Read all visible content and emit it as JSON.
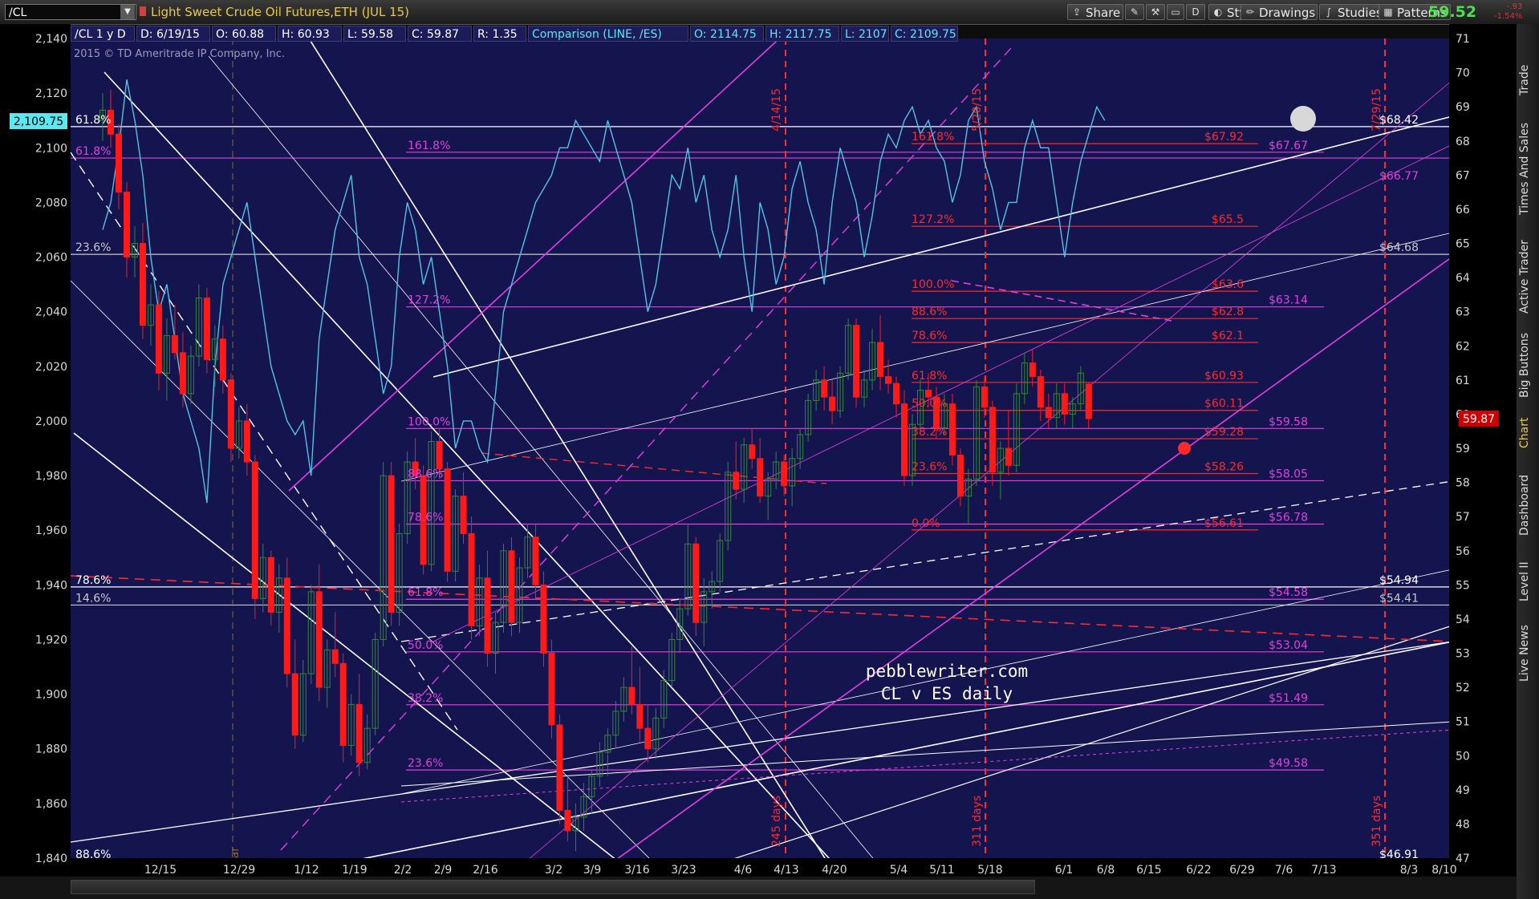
{
  "toolbar": {
    "symbol": "/CL",
    "title": "Light Sweet Crude Oil Futures,ETH (JUL 15)",
    "buttons": {
      "share": "Share",
      "style": "Style",
      "drawings": "Drawings",
      "studies": "Studies",
      "patterns": "Patterns"
    },
    "period_btn": "D",
    "last_price": "59.52",
    "last_change_1": "-.93",
    "last_change_2": "-1.54%"
  },
  "info": {
    "symbol_period": "/CL 1 y D",
    "date": "D: 6/19/15",
    "open": "O: 60.88",
    "high": "H: 60.93",
    "low": "L: 59.58",
    "close": "C: 59.87",
    "range": "R: 1.35",
    "comparison": "Comparison (LINE, /ES)",
    "cmp_open": "O: 2114.75",
    "cmp_high": "H: 2117.75",
    "cmp_low": "L: 2107",
    "cmp_close": "C: 2109.75"
  },
  "copyright": "2015 © TD Ameritrade IP Company, Inc.",
  "watermark": {
    "line1": "pebblewriter.com",
    "line2": "CL v ES daily"
  },
  "side_tabs": [
    "Trade",
    "Times And Sales",
    "Active Trader",
    "Big Buttons",
    "Chart",
    "Dashboard",
    "Level II",
    "Live News"
  ],
  "colors": {
    "bg": "#14144e",
    "up": "#2e8b2e",
    "down": "#ff1a1a",
    "es_line": "#4fc3e8",
    "magenta": "#e040e0",
    "white": "#ffffff",
    "red": "#ff2a2a",
    "current_price_tag": "#cc0000",
    "left_price_tag": "#5ce8f0"
  },
  "chart_data": {
    "type": "candlestick",
    "primary": "/CL",
    "comparison_series": "/ES",
    "x_ticks": [
      "12/15",
      "12/29",
      "1/12",
      "1/19",
      "2/2",
      "2/9",
      "2/16",
      "3/2",
      "3/9",
      "3/16",
      "3/23",
      "4/6",
      "4/13",
      "4/20",
      "5/4",
      "5/11",
      "5/18",
      "6/1",
      "6/8",
      "6/15",
      "6/22",
      "6/29",
      "7/6",
      "7/13",
      "8/3",
      "8/10"
    ],
    "left_axis": {
      "label": "/ES",
      "min": 1840,
      "max": 2140,
      "ticks": [
        "2,140",
        "2,120",
        "2,100",
        "2,080",
        "2,060",
        "2,040",
        "2,020",
        "2,000",
        "1,980",
        "1,960",
        "1,940",
        "1,920",
        "1,900",
        "1,880",
        "1,860",
        "1,840"
      ],
      "current": "2,109.75"
    },
    "right_axis": {
      "label": "/CL",
      "min": 47,
      "max": 71,
      "ticks": [
        "71",
        "70",
        "69",
        "68",
        "67",
        "66",
        "65",
        "64",
        "63",
        "62",
        "61",
        "60",
        "59",
        "58",
        "57",
        "56",
        "55",
        "54",
        "53",
        "52",
        "51",
        "50",
        "49",
        "48",
        "47"
      ],
      "current": "59.87"
    },
    "cl_candles": [
      [
        68.6,
        69.4,
        68.0,
        68.9
      ],
      [
        68.9,
        69.5,
        67.8,
        68.2
      ],
      [
        68.2,
        68.5,
        66.0,
        66.5
      ],
      [
        66.5,
        66.8,
        64.0,
        64.6
      ],
      [
        64.6,
        65.5,
        64.0,
        65.0
      ],
      [
        65.0,
        65.6,
        62.2,
        62.6
      ],
      [
        62.6,
        63.8,
        62.0,
        63.2
      ],
      [
        63.2,
        63.6,
        60.7,
        61.2
      ],
      [
        61.2,
        62.8,
        60.4,
        62.3
      ],
      [
        62.3,
        63.2,
        61.6,
        61.8
      ],
      [
        61.8,
        62.4,
        60.2,
        60.6
      ],
      [
        60.6,
        62.0,
        60.3,
        61.7
      ],
      [
        61.7,
        63.8,
        61.4,
        63.4
      ],
      [
        63.4,
        63.7,
        61.2,
        61.6
      ],
      [
        61.6,
        62.6,
        60.8,
        62.2
      ],
      [
        62.2,
        62.6,
        60.6,
        61.0
      ],
      [
        61.0,
        61.2,
        58.6,
        59.0
      ],
      [
        59.0,
        60.2,
        58.7,
        59.8
      ],
      [
        59.8,
        60.3,
        58.2,
        58.6
      ],
      [
        58.6,
        58.8,
        54.0,
        54.6
      ],
      [
        54.6,
        56.2,
        54.2,
        55.8
      ],
      [
        55.8,
        56.0,
        53.8,
        54.2
      ],
      [
        54.2,
        55.6,
        53.6,
        55.2
      ],
      [
        55.2,
        55.8,
        52.0,
        52.4
      ],
      [
        52.4,
        53.4,
        50.2,
        50.6
      ],
      [
        50.6,
        52.8,
        50.4,
        52.4
      ],
      [
        52.4,
        55.0,
        52.1,
        54.8
      ],
      [
        54.8,
        55.6,
        51.6,
        52.0
      ],
      [
        52.0,
        53.4,
        51.4,
        53.1
      ],
      [
        53.1,
        54.2,
        52.3,
        52.7
      ],
      [
        52.7,
        53.0,
        49.8,
        50.3
      ],
      [
        50.3,
        51.8,
        50.0,
        51.5
      ],
      [
        51.5,
        52.4,
        49.4,
        49.8
      ],
      [
        49.8,
        51.2,
        49.6,
        50.8
      ],
      [
        50.8,
        53.6,
        50.6,
        53.4
      ],
      [
        53.4,
        58.6,
        53.2,
        58.2
      ],
      [
        58.2,
        58.6,
        53.8,
        54.2
      ],
      [
        54.2,
        56.8,
        53.8,
        56.5
      ],
      [
        56.5,
        58.9,
        56.2,
        58.6
      ],
      [
        58.6,
        59.3,
        57.8,
        58.2
      ],
      [
        58.2,
        58.5,
        55.3,
        55.6
      ],
      [
        55.6,
        59.5,
        55.4,
        59.2
      ],
      [
        59.2,
        59.6,
        58.1,
        58.4
      ],
      [
        58.4,
        58.6,
        55.1,
        55.4
      ],
      [
        55.4,
        57.8,
        55.1,
        57.6
      ],
      [
        57.6,
        58.3,
        56.2,
        56.5
      ],
      [
        56.5,
        57.0,
        53.4,
        53.8
      ],
      [
        53.8,
        55.6,
        53.5,
        55.2
      ],
      [
        55.2,
        56.0,
        52.6,
        53.0
      ],
      [
        53.0,
        54.2,
        52.4,
        53.9
      ],
      [
        53.9,
        56.2,
        53.6,
        56.0
      ],
      [
        56.0,
        56.4,
        53.5,
        53.9
      ],
      [
        53.9,
        55.8,
        53.6,
        55.5
      ],
      [
        55.5,
        56.8,
        55.2,
        56.4
      ],
      [
        56.4,
        56.8,
        54.6,
        55.0
      ],
      [
        55.0,
        55.4,
        52.6,
        53.0
      ],
      [
        53.0,
        53.4,
        50.5,
        50.9
      ],
      [
        50.9,
        51.2,
        48.0,
        48.4
      ],
      [
        48.4,
        49.4,
        47.5,
        47.8
      ],
      [
        47.8,
        48.6,
        47.2,
        48.2
      ],
      [
        48.2,
        49.2,
        47.8,
        48.8
      ],
      [
        48.8,
        49.6,
        48.3,
        49.4
      ],
      [
        49.4,
        50.4,
        49.1,
        50.1
      ],
      [
        50.1,
        50.8,
        49.4,
        50.6
      ],
      [
        50.6,
        51.6,
        50.2,
        51.3
      ],
      [
        51.3,
        52.3,
        51.0,
        52.0
      ],
      [
        52.0,
        53.2,
        51.2,
        51.5
      ],
      [
        51.5,
        52.6,
        50.4,
        50.8
      ],
      [
        50.8,
        51.5,
        49.8,
        50.2
      ],
      [
        50.2,
        51.4,
        49.9,
        51.1
      ],
      [
        51.1,
        52.5,
        50.8,
        52.2
      ],
      [
        52.2,
        53.6,
        52.0,
        53.4
      ],
      [
        53.4,
        54.6,
        53.0,
        54.3
      ],
      [
        54.3,
        56.8,
        54.1,
        56.2
      ],
      [
        56.2,
        56.4,
        53.5,
        53.9
      ],
      [
        53.9,
        55.2,
        53.2,
        54.8
      ],
      [
        54.8,
        55.4,
        54.3,
        55.1
      ],
      [
        55.1,
        56.5,
        54.8,
        56.3
      ],
      [
        56.3,
        58.6,
        56.0,
        58.3
      ],
      [
        58.3,
        59.2,
        57.5,
        57.8
      ],
      [
        57.8,
        59.3,
        57.4,
        59.1
      ],
      [
        59.1,
        59.6,
        58.4,
        58.7
      ],
      [
        58.7,
        59.3,
        57.4,
        57.6
      ],
      [
        57.6,
        58.3,
        56.9,
        58.1
      ],
      [
        58.1,
        58.9,
        57.8,
        58.6
      ],
      [
        58.6,
        58.8,
        57.6,
        57.9
      ],
      [
        57.9,
        59.0,
        57.3,
        58.7
      ],
      [
        58.7,
        59.6,
        58.4,
        59.4
      ],
      [
        59.4,
        60.6,
        59.2,
        60.4
      ],
      [
        60.4,
        61.3,
        60.1,
        61.0
      ],
      [
        61.0,
        61.4,
        60.1,
        60.5
      ],
      [
        60.5,
        61.0,
        59.7,
        60.1
      ],
      [
        60.1,
        61.4,
        59.9,
        61.2
      ],
      [
        61.2,
        62.8,
        61.0,
        62.6
      ],
      [
        62.6,
        62.8,
        60.2,
        60.5
      ],
      [
        60.5,
        61.3,
        60.2,
        61.0
      ],
      [
        61.0,
        62.5,
        60.7,
        62.1
      ],
      [
        62.1,
        62.9,
        60.7,
        61.1
      ],
      [
        61.1,
        61.6,
        60.6,
        60.9
      ],
      [
        60.9,
        61.1,
        59.9,
        60.3
      ],
      [
        60.3,
        60.7,
        57.9,
        58.2
      ],
      [
        58.2,
        60.0,
        57.9,
        59.7
      ],
      [
        59.7,
        61.0,
        59.4,
        60.7
      ],
      [
        60.7,
        61.2,
        60.2,
        60.5
      ],
      [
        60.5,
        60.8,
        59.3,
        59.6
      ],
      [
        59.6,
        60.6,
        59.4,
        60.3
      ],
      [
        60.3,
        60.6,
        58.5,
        58.8
      ],
      [
        58.8,
        59.0,
        57.3,
        57.6
      ],
      [
        57.6,
        58.4,
        56.8,
        58.1
      ],
      [
        58.1,
        61.0,
        57.9,
        60.8
      ],
      [
        60.8,
        61.1,
        59.9,
        60.2
      ],
      [
        60.2,
        60.4,
        57.9,
        58.3
      ],
      [
        58.3,
        59.2,
        57.5,
        59.0
      ],
      [
        59.0,
        60.1,
        58.2,
        58.5
      ],
      [
        58.5,
        60.9,
        58.3,
        60.6
      ],
      [
        60.6,
        61.8,
        60.3,
        61.5
      ],
      [
        61.5,
        61.9,
        60.8,
        61.1
      ],
      [
        61.1,
        61.3,
        59.8,
        60.2
      ],
      [
        60.2,
        60.6,
        59.6,
        59.9
      ],
      [
        59.9,
        60.9,
        59.6,
        60.6
      ],
      [
        60.6,
        60.9,
        59.7,
        60.0
      ],
      [
        60.0,
        60.5,
        59.6,
        60.3
      ],
      [
        60.3,
        61.4,
        60.1,
        61.2
      ],
      [
        60.88,
        60.93,
        59.58,
        59.87
      ]
    ],
    "es_close": [
      2070,
      2080,
      2100,
      2125,
      2110,
      2090,
      2060,
      2040,
      2050,
      2030,
      2010,
      2000,
      1990,
      1970,
      2020,
      2050,
      2060,
      2070,
      2080,
      2060,
      2040,
      2020,
      2010,
      2000,
      1995,
      2000,
      1980,
      2030,
      2050,
      2070,
      2080,
      2090,
      2060,
      2050,
      2030,
      2010,
      2020,
      2060,
      2080,
      2070,
      2050,
      2060,
      2040,
      2020,
      1990,
      2000,
      2000,
      1990,
      1985,
      2010,
      2040,
      2050,
      2060,
      2070,
      2080,
      2085,
      2090,
      2100,
      2100,
      2110,
      2105,
      2100,
      2095,
      2110,
      2100,
      2090,
      2080,
      2060,
      2040,
      2050,
      2070,
      2090,
      2085,
      2100,
      2080,
      2090,
      2070,
      2060,
      2070,
      2090,
      2060,
      2040,
      2080,
      2070,
      2050,
      2060,
      2085,
      2095,
      2080,
      2070,
      2050,
      2080,
      2100,
      2090,
      2080,
      2060,
      2075,
      2095,
      2105,
      2100,
      2110,
      2115,
      2105,
      2110,
      2100,
      2095,
      2080,
      2090,
      2110,
      2115,
      2095,
      2085,
      2070,
      2080,
      2080,
      2100,
      2110,
      2100,
      2100,
      2080,
      2060,
      2080,
      2095,
      2105,
      2115,
      2110
    ],
    "fib_labels": [
      {
        "text": "61.8%"
      },
      {
        "text": "61.8%"
      },
      {
        "text": "23.6%"
      },
      {
        "text": "78.6%"
      },
      {
        "text": "14.6%"
      },
      {
        "text": "88.6%"
      },
      {
        "text": "127.2%"
      },
      {
        "text": "161.8%"
      },
      {
        "text": "127.2%"
      },
      {
        "text": "100.0%"
      },
      {
        "text": "88.6%"
      },
      {
        "text": "78.6%"
      },
      {
        "text": "61.8%"
      },
      {
        "text": "50.0%"
      },
      {
        "text": "38.2%"
      },
      {
        "text": "23.6%"
      },
      {
        "text": "0.0%"
      },
      {
        "text": "161.8%"
      },
      {
        "text": "127.2%"
      },
      {
        "text": "100.0%"
      },
      {
        "text": "88.6%"
      },
      {
        "text": "78.6%"
      },
      {
        "text": "61.8%"
      },
      {
        "text": "50.0%"
      },
      {
        "text": "38.2%"
      },
      {
        "text": "23.6%"
      },
      {
        "text": "0.0%"
      }
    ],
    "price_labels": [
      {
        "text": "$67.92"
      },
      {
        "text": "$65.5"
      },
      {
        "text": "$63.6"
      },
      {
        "text": "$62.8"
      },
      {
        "text": "$62.1"
      },
      {
        "text": "$60.93"
      },
      {
        "text": "$60.11"
      },
      {
        "text": "$59.28"
      },
      {
        "text": "$58.26"
      },
      {
        "text": "$56.61"
      },
      {
        "text": "$67.67"
      },
      {
        "text": "$63.14"
      },
      {
        "text": "$59.58"
      },
      {
        "text": "$58.05"
      },
      {
        "text": "$56.78"
      },
      {
        "text": "$54.58"
      },
      {
        "text": "$53.04"
      },
      {
        "text": "$51.49"
      },
      {
        "text": "$49.58"
      },
      {
        "text": "$46.49"
      },
      {
        "text": "$68.42"
      },
      {
        "text": "$66.77"
      },
      {
        "text": "$64.68"
      },
      {
        "text": "$54.94"
      },
      {
        "text": "$54.41"
      },
      {
        "text": "$46.91"
      },
      {
        "text": "$−23.25"
      }
    ],
    "vline_labels": [
      {
        "text": "2014 year"
      },
      {
        "text": "4/14/15"
      },
      {
        "text": "245 days"
      },
      {
        "text": "5/20/15"
      },
      {
        "text": "311 days"
      },
      {
        "text": "7/29/15"
      },
      {
        "text": "351 days"
      }
    ]
  }
}
